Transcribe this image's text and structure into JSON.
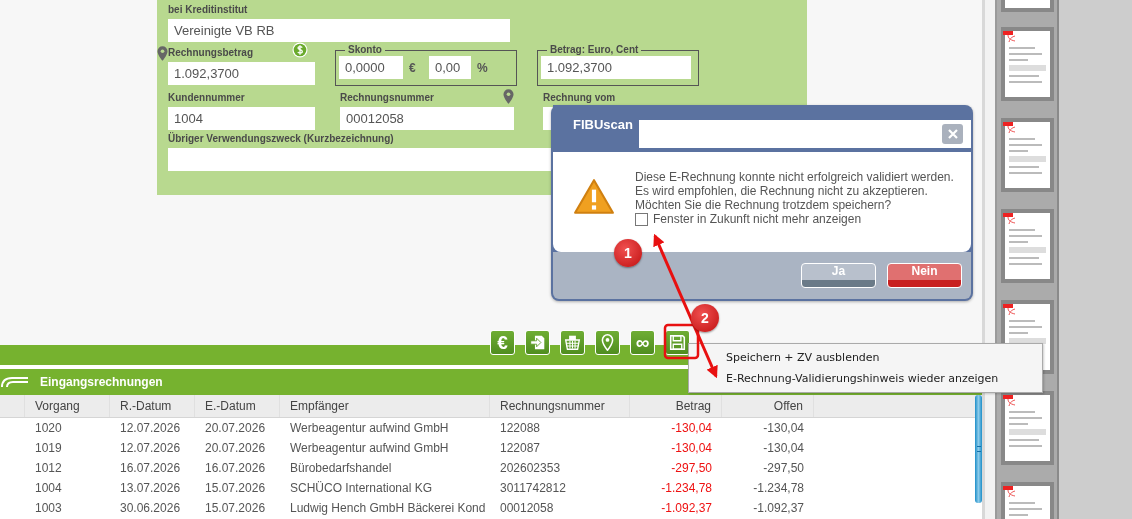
{
  "form": {
    "bank_label": "bei Kreditinstitut",
    "bank_value": "Vereinigte VB RB",
    "amount_label": "Rechnungsbetrag",
    "amount_value": "1.092,3700",
    "skonto": {
      "legend": "Skonto",
      "amount": "0,0000",
      "currency": "€",
      "percent": "0,00",
      "percent_sign": "%"
    },
    "euro": {
      "legend": "Betrag: Euro, Cent",
      "value": "1.092,3700"
    },
    "customer_label": "Kundennummer",
    "customer_value": "1004",
    "invoice_no_label": "Rechnungsnummer",
    "invoice_no_value": "00012058",
    "invoice_date_label": "Rechnung vom",
    "purpose_label": "Übriger Verwendungszweck (Kurzbezeichnung)"
  },
  "toolbar": [
    {
      "kind": "glyph",
      "glyph": "€"
    },
    {
      "kind": "export"
    },
    {
      "kind": "basket"
    },
    {
      "kind": "pin"
    },
    {
      "kind": "glyph",
      "glyph": "∞"
    },
    {
      "kind": "save"
    }
  ],
  "section_title": "Eingangsrechnungen",
  "table": {
    "columns": [
      "Vorgang",
      "R.-Datum",
      "E.-Datum",
      "Empfänger",
      "Rechnungsnummer",
      "Betrag",
      "Offen"
    ],
    "rows": [
      [
        "1020",
        "12.07.2026",
        "20.07.2026",
        "Werbeagentur aufwind GmbH",
        "122088",
        "-130,04",
        "-130,04"
      ],
      [
        "1019",
        "12.07.2026",
        "20.07.2026",
        "Werbeagentur aufwind GmbH",
        "122087",
        "-130,04",
        "-130,04"
      ],
      [
        "1012",
        "16.07.2026",
        "16.07.2026",
        "Bürobedarfshandel",
        "202602353",
        "-297,50",
        "-297,50"
      ],
      [
        "1004",
        "13.07.2026",
        "15.07.2026",
        "SCHÜCO International KG",
        "3011742812",
        "-1.234,78",
        "-1.234,78"
      ],
      [
        "1003",
        "30.06.2026",
        "15.07.2026",
        "Ludwig Hench GmbH Bäckerei Kond",
        "00012058",
        "-1.092,37",
        "-1.092,37"
      ]
    ]
  },
  "dialog": {
    "title": "FIBUscan",
    "message": [
      "Diese E-Rechnung konnte nicht erfolgreich validiert werden.",
      "Es wird empfohlen, die Rechnung nicht zu akzeptieren.",
      "Möchten Sie die Rechnung trotzdem speichern?"
    ],
    "checkbox": {
      "label": "Fenster in Zukunft nicht mehr anzeigen",
      "checked": false
    },
    "buttons": [
      {
        "label": "Ja",
        "kind": "neutral"
      },
      {
        "label": "Nein",
        "kind": "danger"
      }
    ]
  },
  "context_menu": [
    "Speichern + ZV ausblenden",
    "E-Rechnung-Validierungshinweis wieder anzeigen"
  ],
  "annotations": [
    {
      "label": "1"
    },
    {
      "label": "2"
    }
  ]
}
